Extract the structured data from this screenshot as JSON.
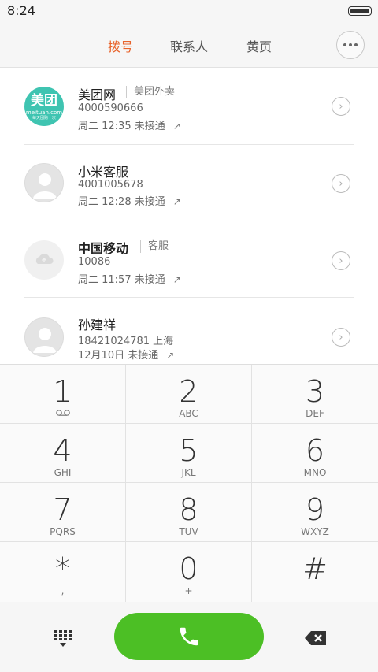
{
  "status": {
    "time": "8:24"
  },
  "tabs": [
    {
      "label": "拨号",
      "active": true
    },
    {
      "label": "联系人",
      "active": false
    },
    {
      "label": "黄页",
      "active": false
    }
  ],
  "calls": [
    {
      "name": "美团网",
      "tag": "美团外卖",
      "number": "4000590666",
      "meta": "周二 12:35 未接通",
      "avatar": {
        "type": "meituan",
        "big": "美团",
        "small": "meituan.com",
        "tiny": "每天团购一次"
      }
    },
    {
      "name": "小米客服",
      "tag": "",
      "number": "4001005678",
      "meta": "周二 12:28 未接通",
      "avatar": {
        "type": "person"
      }
    },
    {
      "name": "中国移动",
      "tag": "客服",
      "number": "10086",
      "meta": "周二 11:57 未接通",
      "avatar": {
        "type": "cloud"
      }
    },
    {
      "name": "孙建祥",
      "tag": "",
      "number": "18421024781  上海",
      "meta": "12月10日 未接通",
      "avatar": {
        "type": "person"
      }
    }
  ],
  "dialpad": {
    "keys": [
      {
        "digit": "1",
        "letters": ""
      },
      {
        "digit": "2",
        "letters": "ABC"
      },
      {
        "digit": "3",
        "letters": "DEF"
      },
      {
        "digit": "4",
        "letters": "GHI"
      },
      {
        "digit": "5",
        "letters": "JKL"
      },
      {
        "digit": "6",
        "letters": "MNO"
      },
      {
        "digit": "7",
        "letters": "PQRS"
      },
      {
        "digit": "8",
        "letters": "TUV"
      },
      {
        "digit": "9",
        "letters": "WXYZ"
      },
      {
        "digit": "*",
        "letters": ","
      },
      {
        "digit": "0",
        "letters": "+"
      },
      {
        "digit": "#",
        "letters": ""
      }
    ]
  },
  "colors": {
    "accent": "#e8632b",
    "call_button": "#4cbf25",
    "meituan": "#3fc4b1"
  },
  "icons": {
    "more": "more-dots-icon",
    "detail": "chevron-right-circle-icon",
    "outgoing": "outgoing-arrow-icon",
    "voicemail": "voicemail-icon",
    "keypad": "dialpad-grid-icon",
    "call": "phone-icon",
    "backspace": "backspace-icon"
  }
}
